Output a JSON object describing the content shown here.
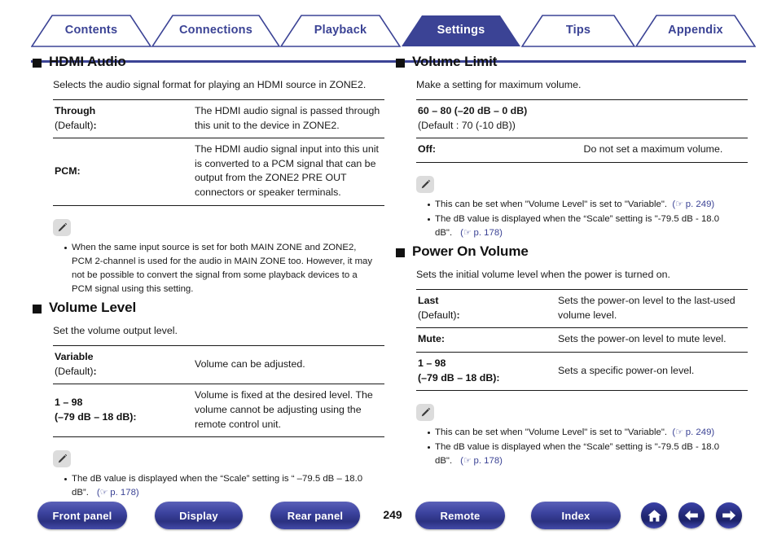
{
  "tabs": [
    {
      "label": "Contents",
      "active": false
    },
    {
      "label": "Connections",
      "active": false
    },
    {
      "label": "Playback",
      "active": false
    },
    {
      "label": "Settings",
      "active": true
    },
    {
      "label": "Tips",
      "active": false
    },
    {
      "label": "Appendix",
      "active": false
    }
  ],
  "colors": {
    "brand_blue": "#3b4395",
    "active_tab_fill": "#3b4395",
    "text": "#1a1a1a",
    "note_icon_bg": "#dcdcdc"
  },
  "left_column": {
    "sections": [
      {
        "title": "HDMI Audio",
        "intro": "Selects the audio signal format for playing an HDMI source in ZONE2.",
        "rows": [
          {
            "term": "Through",
            "term_sub": "(Default)",
            "desc": "The HDMI audio signal is passed through this unit to the device in ZONE2."
          },
          {
            "term": "PCM:",
            "term_sub": "",
            "desc": "The HDMI audio signal input into this unit is converted to a PCM signal that can be output from the ZONE2 PRE OUT connectors or speaker terminals."
          }
        ],
        "notes": [
          "When the same input source is set for both MAIN ZONE and ZONE2, PCM 2-channel is used for the audio in MAIN ZONE too. However, it may not be possible to convert the signal from some playback devices to a PCM signal using this setting."
        ]
      },
      {
        "title": "Volume Level",
        "intro": "Set the volume output level.",
        "rows": [
          {
            "term": "Variable",
            "term_sub": "(Default)",
            "desc": "Volume can be adjusted."
          },
          {
            "term": "1 – 98",
            "term_sub2": "(–79 dB – 18 dB):",
            "desc": "Volume is fixed at the desired level. The volume cannot be adjusting using the remote control unit."
          }
        ],
        "notes": [
          "The dB value is displayed when the “Scale” setting is “ –79.5 dB – 18.0 dB”."
        ],
        "note_refs": [
          "p. 178"
        ]
      }
    ]
  },
  "right_column": {
    "sections": [
      {
        "title": "Volume Limit",
        "intro": "Make a setting for maximum volume.",
        "rows": [
          {
            "term": "60 – 80 (–20 dB – 0 dB)",
            "term_sub": "(Default : 70 (-10 dB))",
            "desc": "",
            "full_width": true
          },
          {
            "term": "Off:",
            "term_sub": "",
            "desc": "Do not set a maximum volume."
          }
        ],
        "notes": [
          "This can be set when \"Volume Level\" is set to \"Variable\".",
          "The dB value is displayed when the “Scale” setting is \"-79.5 dB - 18.0 dB\"."
        ],
        "note_refs": [
          "p. 249",
          "p. 178"
        ]
      },
      {
        "title": "Power On Volume",
        "intro": "Sets the initial volume level when the power is turned on.",
        "rows": [
          {
            "term": "Last",
            "term_sub": "(Default)",
            "desc": "Sets the power-on level to the last-used volume level."
          },
          {
            "term": "Mute:",
            "term_sub": "",
            "desc": "Sets the power-on level to mute level."
          },
          {
            "term": "1 – 98",
            "term_sub2": "(–79 dB – 18 dB):",
            "desc": "Sets a specific power-on level."
          }
        ],
        "notes": [
          "This can be set when \"Volume Level\" is set to \"Variable\".",
          "The dB value is displayed when the “Scale” setting is \"-79.5 dB - 18.0 dB\"."
        ],
        "note_refs": [
          "p. 249",
          "p. 178"
        ]
      }
    ]
  },
  "footer": {
    "page_number": "249",
    "buttons": [
      {
        "label": "Front panel"
      },
      {
        "label": "Display"
      },
      {
        "label": "Rear panel"
      },
      {
        "label": "Remote"
      },
      {
        "label": "Index"
      }
    ],
    "icons": [
      {
        "name": "home-icon"
      },
      {
        "name": "arrow-left-icon"
      },
      {
        "name": "arrow-right-icon"
      }
    ]
  }
}
